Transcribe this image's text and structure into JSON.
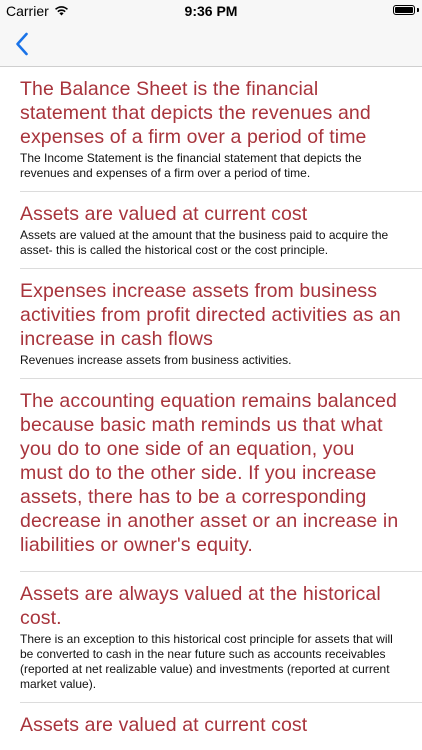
{
  "status_bar": {
    "carrier": "Carrier",
    "time": "9:36 PM"
  },
  "nav": {
    "accent_color": "#1a73e8"
  },
  "colors": {
    "title_color": "#a8343c",
    "body_color": "#111111"
  },
  "items": [
    {
      "title": "The Balance Sheet is the financial statement that depicts the revenues and expenses of a firm over a period of time",
      "body": "The Income Statement is the financial statement that depicts the revenues and expenses of a firm over a period of time."
    },
    {
      "title": "Assets are valued at current cost",
      "body": "Assets are valued at the amount that the business paid to acquire the asset- this is called the historical cost or the cost principle."
    },
    {
      "title": "Expenses increase assets from business activities from profit directed activities as an increase in cash flows",
      "body": "Revenues increase assets from business activities."
    },
    {
      "title": "The accounting equation remains balanced because basic math reminds us that what you do to one side of an equation, you must do to the other side. If you increase assets, there has to be a corresponding decrease in another asset or an increase in liabilities or owner's equity.",
      "body": ""
    },
    {
      "title": "Assets are always valued at the historical cost.",
      "body": "There is an exception to this historical cost principle for assets that will be converted to cash in the near future such as accounts receivables (reported at net realizable value) and investments (reported at current market value)."
    },
    {
      "title": "Assets are valued at current cost",
      "body": ""
    }
  ]
}
